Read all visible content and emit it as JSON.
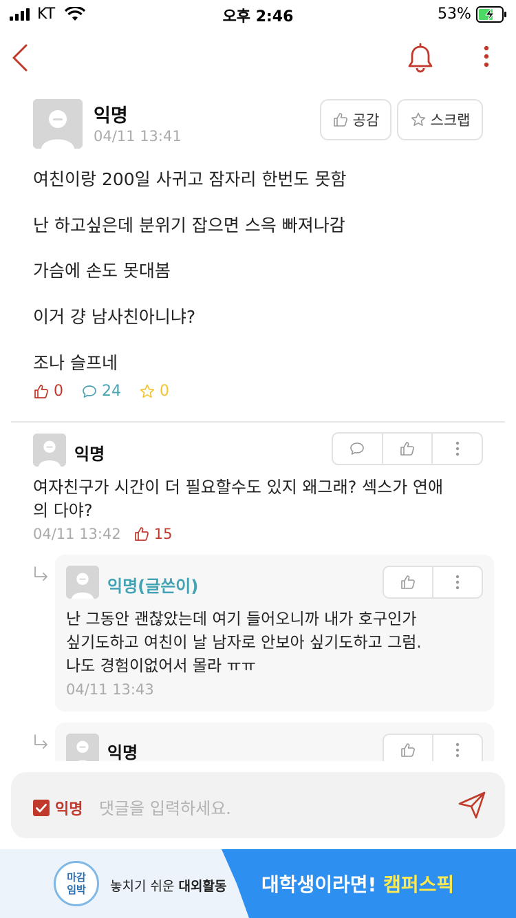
{
  "status_bar": {
    "carrier": "KT",
    "time": "오후 2:46",
    "battery": "53%"
  },
  "post": {
    "author": "익명",
    "date": "04/11 13:41",
    "like_label": "공감",
    "scrap_label": "스크랩",
    "lines": [
      "여친이랑 200일 사귀고 잠자리 한번도 못함",
      "난 하고싶은데 분위기 잡으면 스윽 빠져나감",
      "가슴에 손도 못대봄",
      "이거 걍 남사친아니냐?",
      "조나 슬프네"
    ],
    "stats": {
      "likes": "0",
      "comments": "24",
      "scraps": "0"
    }
  },
  "comments": [
    {
      "author": "익명",
      "text_line1": "여자친구가 시간이 더 필요할수도 있지 왜그래? 섹스가 연애",
      "text_line2": "의 다야?",
      "date": "04/11 13:42",
      "likes": "15"
    }
  ],
  "replies": [
    {
      "author": "익명(글쓴이)",
      "text_line1": "난 그동안 괜찮았는데 여기 들어오니까 내가 호구인가",
      "text_line2": "싶기도하고 여친이 날 남자로 안보아 싶기도하고 그럼.",
      "text_line3": "나도 경험이없어서 몰라 ㅠㅠ",
      "date": "04/11 13:43"
    },
    {
      "author": "익명"
    }
  ],
  "input": {
    "anon_label": "익명",
    "placeholder": "댓글을 입력하세요."
  },
  "ad": {
    "badge_line1": "마감",
    "badge_line2": "임박",
    "left_text": "놓치기 쉬운 ",
    "left_bold": "대외활동",
    "right_text": "대학생이라면! ",
    "right_highlight": "캠퍼스픽"
  },
  "colors": {
    "accent_red": "#c0392b",
    "comment_teal": "#4aa3b5",
    "scrap_yellow": "#f3c431",
    "author_teal": "#41a3b3",
    "battery_green": "#4cd964",
    "ad_blue": "#2d8ff0"
  }
}
